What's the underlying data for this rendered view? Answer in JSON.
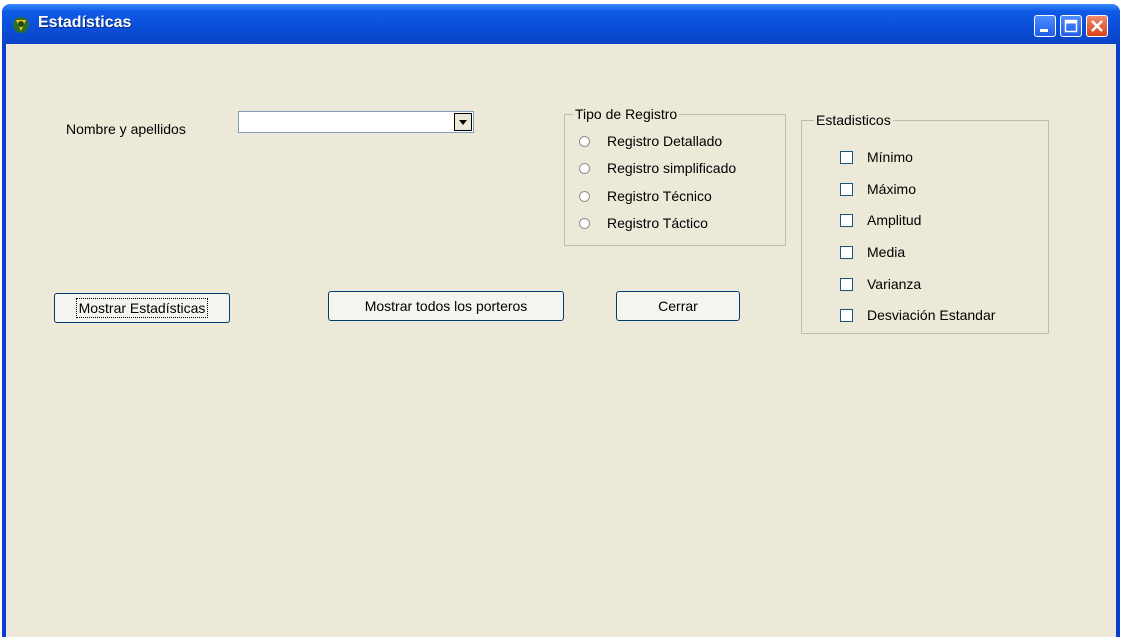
{
  "window": {
    "title": "Estadísticas",
    "icon": "app-icon"
  },
  "form": {
    "name_label": "Nombre y apellidos",
    "name_value": "",
    "tipo_registro": {
      "title": "Tipo de Registro",
      "options": [
        "Registro Detallado",
        "Registro simplificado",
        "Registro Técnico",
        "Registro Táctico"
      ]
    },
    "estadisticos": {
      "title": "Estadisticos",
      "options": [
        "Mínimo",
        "Máximo",
        "Amplitud",
        "Media",
        "Varianza",
        "Desviación Estandar"
      ]
    },
    "buttons": {
      "mostrar_estadisticas": "Mostrar Estadísticas",
      "mostrar_porteros": "Mostrar todos los porteros",
      "cerrar": "Cerrar"
    }
  }
}
